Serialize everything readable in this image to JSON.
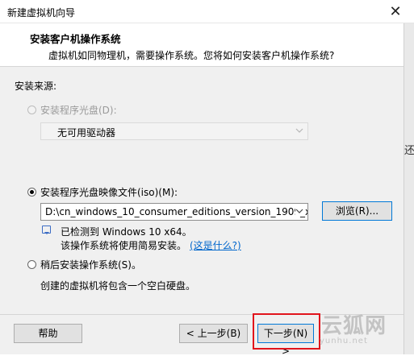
{
  "window": {
    "title": "新建虚拟机向导",
    "close_glyph": "✕"
  },
  "header": {
    "title": "安装客户机操作系统",
    "subtitle": "虚拟机如同物理机，需要操作系统。您将如何安装客户机操作系统?"
  },
  "source": {
    "label": "安装来源:",
    "disc": {
      "label": "安装程序光盘(D):",
      "selected": false,
      "enabled": false,
      "drive_value": "无可用驱动器"
    },
    "iso": {
      "label": "安装程序光盘映像文件(iso)(M):",
      "selected": true,
      "path_value": "D:\\cn_windows_10_consumer_editions_version_1909_x",
      "browse_label": "浏览(R)...",
      "detect_line1": "已检测到 Windows 10 x64。",
      "detect_line2": "该操作系统将使用简易安装。",
      "whats_this": "(这是什么?)"
    },
    "later": {
      "label": "稍后安装操作系统(S)。",
      "selected": false,
      "description": "创建的虚拟机将包含一个空白硬盘。"
    }
  },
  "footer": {
    "help_label": "帮助",
    "back_label": "< 上一步(B)",
    "next_label": "下一步(N) >"
  },
  "side_fragment": "还",
  "watermark": {
    "main": "云狐网",
    "sub": "yunhu.net"
  },
  "colors": {
    "highlight": "#e1141c",
    "link": "#0066cc",
    "panel_bg": "#f0f0f0"
  }
}
